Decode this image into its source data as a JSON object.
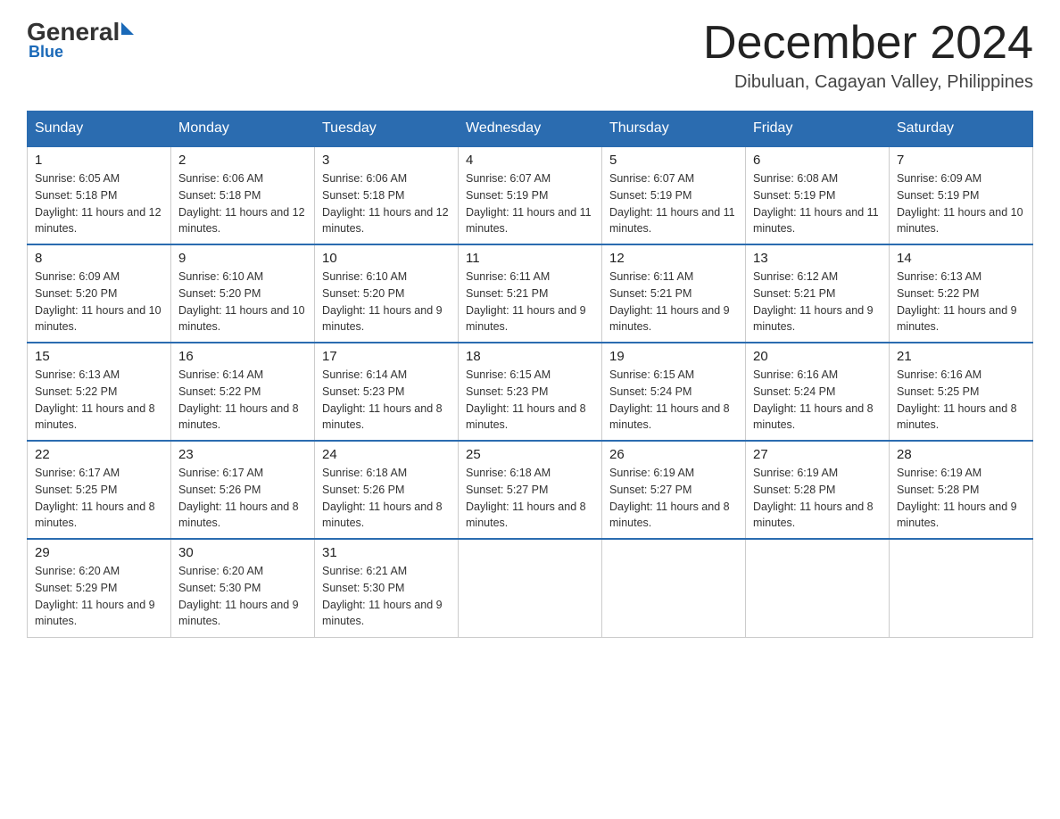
{
  "header": {
    "logo_general": "General",
    "logo_blue": "Blue",
    "month_title": "December 2024",
    "location": "Dibuluan, Cagayan Valley, Philippines"
  },
  "days_of_week": [
    "Sunday",
    "Monday",
    "Tuesday",
    "Wednesday",
    "Thursday",
    "Friday",
    "Saturday"
  ],
  "weeks": [
    [
      {
        "day": "1",
        "sunrise": "6:05 AM",
        "sunset": "5:18 PM",
        "daylight": "11 hours and 12 minutes."
      },
      {
        "day": "2",
        "sunrise": "6:06 AM",
        "sunset": "5:18 PM",
        "daylight": "11 hours and 12 minutes."
      },
      {
        "day": "3",
        "sunrise": "6:06 AM",
        "sunset": "5:18 PM",
        "daylight": "11 hours and 12 minutes."
      },
      {
        "day": "4",
        "sunrise": "6:07 AM",
        "sunset": "5:19 PM",
        "daylight": "11 hours and 11 minutes."
      },
      {
        "day": "5",
        "sunrise": "6:07 AM",
        "sunset": "5:19 PM",
        "daylight": "11 hours and 11 minutes."
      },
      {
        "day": "6",
        "sunrise": "6:08 AM",
        "sunset": "5:19 PM",
        "daylight": "11 hours and 11 minutes."
      },
      {
        "day": "7",
        "sunrise": "6:09 AM",
        "sunset": "5:19 PM",
        "daylight": "11 hours and 10 minutes."
      }
    ],
    [
      {
        "day": "8",
        "sunrise": "6:09 AM",
        "sunset": "5:20 PM",
        "daylight": "11 hours and 10 minutes."
      },
      {
        "day": "9",
        "sunrise": "6:10 AM",
        "sunset": "5:20 PM",
        "daylight": "11 hours and 10 minutes."
      },
      {
        "day": "10",
        "sunrise": "6:10 AM",
        "sunset": "5:20 PM",
        "daylight": "11 hours and 9 minutes."
      },
      {
        "day": "11",
        "sunrise": "6:11 AM",
        "sunset": "5:21 PM",
        "daylight": "11 hours and 9 minutes."
      },
      {
        "day": "12",
        "sunrise": "6:11 AM",
        "sunset": "5:21 PM",
        "daylight": "11 hours and 9 minutes."
      },
      {
        "day": "13",
        "sunrise": "6:12 AM",
        "sunset": "5:21 PM",
        "daylight": "11 hours and 9 minutes."
      },
      {
        "day": "14",
        "sunrise": "6:13 AM",
        "sunset": "5:22 PM",
        "daylight": "11 hours and 9 minutes."
      }
    ],
    [
      {
        "day": "15",
        "sunrise": "6:13 AM",
        "sunset": "5:22 PM",
        "daylight": "11 hours and 8 minutes."
      },
      {
        "day": "16",
        "sunrise": "6:14 AM",
        "sunset": "5:22 PM",
        "daylight": "11 hours and 8 minutes."
      },
      {
        "day": "17",
        "sunrise": "6:14 AM",
        "sunset": "5:23 PM",
        "daylight": "11 hours and 8 minutes."
      },
      {
        "day": "18",
        "sunrise": "6:15 AM",
        "sunset": "5:23 PM",
        "daylight": "11 hours and 8 minutes."
      },
      {
        "day": "19",
        "sunrise": "6:15 AM",
        "sunset": "5:24 PM",
        "daylight": "11 hours and 8 minutes."
      },
      {
        "day": "20",
        "sunrise": "6:16 AM",
        "sunset": "5:24 PM",
        "daylight": "11 hours and 8 minutes."
      },
      {
        "day": "21",
        "sunrise": "6:16 AM",
        "sunset": "5:25 PM",
        "daylight": "11 hours and 8 minutes."
      }
    ],
    [
      {
        "day": "22",
        "sunrise": "6:17 AM",
        "sunset": "5:25 PM",
        "daylight": "11 hours and 8 minutes."
      },
      {
        "day": "23",
        "sunrise": "6:17 AM",
        "sunset": "5:26 PM",
        "daylight": "11 hours and 8 minutes."
      },
      {
        "day": "24",
        "sunrise": "6:18 AM",
        "sunset": "5:26 PM",
        "daylight": "11 hours and 8 minutes."
      },
      {
        "day": "25",
        "sunrise": "6:18 AM",
        "sunset": "5:27 PM",
        "daylight": "11 hours and 8 minutes."
      },
      {
        "day": "26",
        "sunrise": "6:19 AM",
        "sunset": "5:27 PM",
        "daylight": "11 hours and 8 minutes."
      },
      {
        "day": "27",
        "sunrise": "6:19 AM",
        "sunset": "5:28 PM",
        "daylight": "11 hours and 8 minutes."
      },
      {
        "day": "28",
        "sunrise": "6:19 AM",
        "sunset": "5:28 PM",
        "daylight": "11 hours and 9 minutes."
      }
    ],
    [
      {
        "day": "29",
        "sunrise": "6:20 AM",
        "sunset": "5:29 PM",
        "daylight": "11 hours and 9 minutes."
      },
      {
        "day": "30",
        "sunrise": "6:20 AM",
        "sunset": "5:30 PM",
        "daylight": "11 hours and 9 minutes."
      },
      {
        "day": "31",
        "sunrise": "6:21 AM",
        "sunset": "5:30 PM",
        "daylight": "11 hours and 9 minutes."
      },
      null,
      null,
      null,
      null
    ]
  ],
  "labels": {
    "sunrise": "Sunrise:",
    "sunset": "Sunset:",
    "daylight": "Daylight:"
  }
}
